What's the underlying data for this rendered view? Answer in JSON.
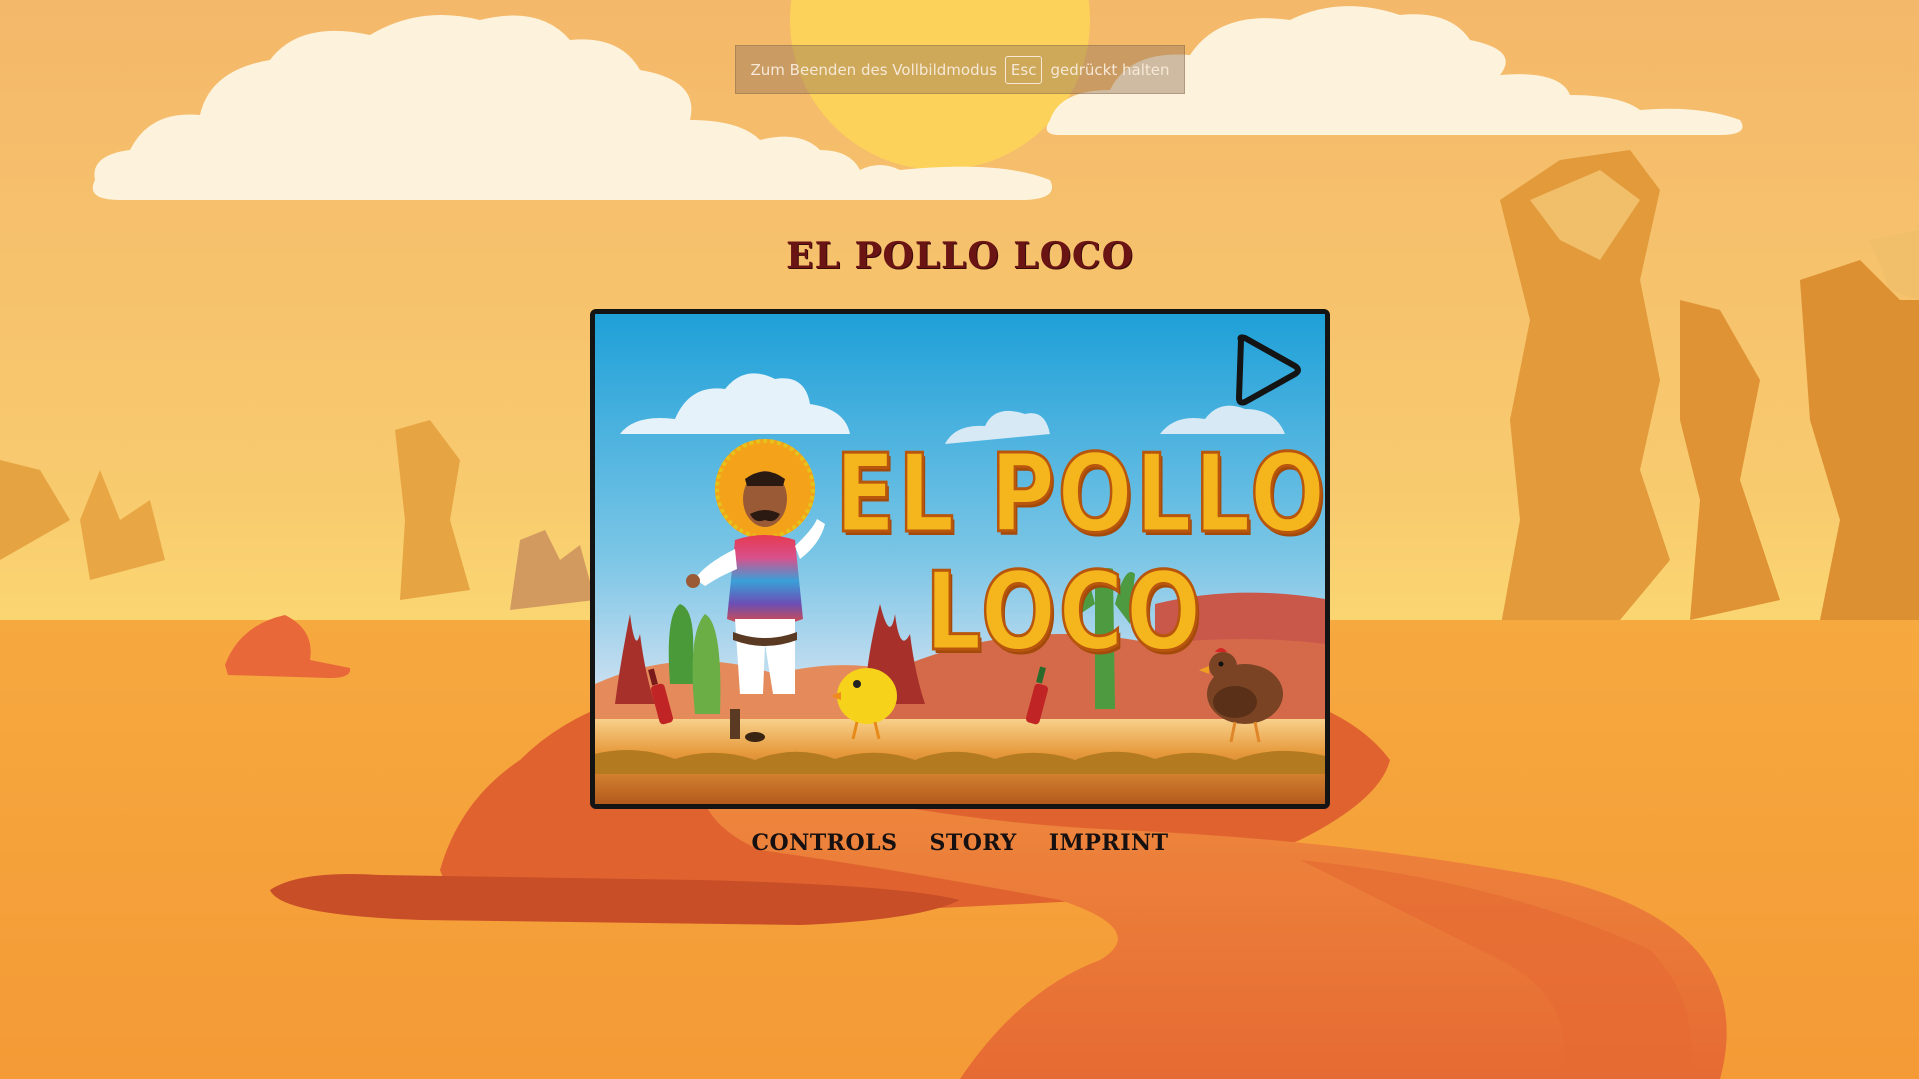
{
  "fullscreen_notice": {
    "prefix": "Zum Beenden des Vollbildmodus",
    "key": "Esc",
    "suffix": "gedrückt halten"
  },
  "header": {
    "title": "EL POLLO LOCO"
  },
  "game": {
    "logo_line1": "EL POLLO",
    "logo_line2": "LOCO",
    "play_icon": "play-triangle-icon"
  },
  "menu": {
    "items": [
      {
        "label": "CONTROLS"
      },
      {
        "label": "STORY"
      },
      {
        "label": "IMPRINT"
      }
    ]
  },
  "colors": {
    "sky_top": "#f3b86a",
    "sand": "#f6a33b",
    "path": "#e8733a",
    "title": "#6b1414",
    "frame_border": "#141414",
    "logo_fill": "#f5b51c",
    "logo_outline": "#b8560d"
  }
}
